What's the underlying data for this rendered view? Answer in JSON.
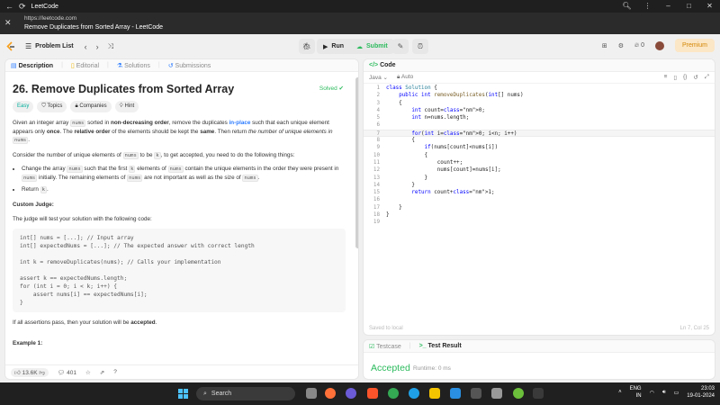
{
  "browser": {
    "app_name": "LeetCode",
    "url": "https://leetcode.com",
    "page_title": "Remove Duplicates from Sorted Array - LeetCode"
  },
  "nav": {
    "problem_list": "Problem List",
    "run": "Run",
    "submit": "Submit",
    "streak_count": "0",
    "premium": "Premium"
  },
  "left_tabs": [
    "Description",
    "Editorial",
    "Solutions",
    "Submissions"
  ],
  "problem": {
    "title": "26. Remove Duplicates from Sorted Array",
    "status": "Solved",
    "difficulty": "Easy",
    "topics": "Topics",
    "companies": "Companies",
    "hint": "Hint",
    "p1_a": "Given an integer array",
    "p1_code": "nums",
    "p1_b": "sorted in",
    "p1_bold1": "non-decreasing order",
    "p1_c": ", remove the duplicates",
    "p1_inplace": "in-place",
    "p1_d": "such that each unique element appears only",
    "p1_once": "once",
    "p1_e": ". The",
    "p1_relorder": "relative order",
    "p1_f": "of the elements should be kept the",
    "p1_same": "same",
    "p1_g": ". Then return",
    "p1_italic": "the number of unique elements in",
    "p1_code2": "nums",
    "p1_h": ".",
    "p2_a": "Consider the number of unique elements of",
    "p2_code": "nums",
    "p2_b": "to be",
    "p2_code2": "k",
    "p2_c": ", to get accepted, you need to do the following things:",
    "b1_a": "Change the array",
    "b1_code": "nums",
    "b1_b": "such that the first",
    "b1_code2": "k",
    "b1_c": "elements of",
    "b1_code3": "nums",
    "b1_d": "contain the unique elements in the order they were present in",
    "b1_code4": "nums",
    "b1_e": "initially. The remaining elements of",
    "b1_code5": "nums",
    "b1_f": "are not important as well as the size of",
    "b1_code6": "nums",
    "b1_g": ".",
    "b2_a": "Return",
    "b2_code": "k",
    "b2_b": ".",
    "custom_judge": "Custom Judge:",
    "judge_text": "The judge will test your solution with the following code:",
    "judge_code": "int[] nums = [...]; // Input array\nint[] expectedNums = [...]; // The expected answer with correct length\n\nint k = removeDuplicates(nums); // Calls your implementation\n\nassert k == expectedNums.length;\nfor (int i = 0; i < k; i++) {\n    assert nums[i] == expectedNums[i];\n}",
    "final_a": "If all assertions pass, then your solution will be",
    "final_bold": "accepted",
    "final_b": ".",
    "example1": "Example 1:"
  },
  "left_footer": {
    "likes": "13.6K",
    "comments": "401"
  },
  "code_panel": {
    "tab": "Code",
    "language": "Java",
    "auto": "Auto",
    "saved": "Saved to local",
    "cursor": "Ln 7, Col 25",
    "lines": [
      "class Solution {",
      "    public int removeDuplicates(int[] nums)",
      "    {",
      "        int count=0;",
      "        int n=nums.length;",
      "",
      "        for(int i=0; i<n; i++)",
      "        {",
      "            if(nums[count]<nums[i])",
      "            {",
      "                count++;",
      "                nums[count]=nums[i];",
      "            }",
      "        }",
      "        return count+1;",
      "",
      "    }",
      "}",
      ""
    ]
  },
  "result_panel": {
    "testcase": "Testcase",
    "test_result": "Test Result",
    "verdict": "Accepted",
    "runtime": "Runtime: 0 ms"
  },
  "taskbar": {
    "search": "Search",
    "lang": "ENG",
    "region": "IN",
    "time": "23:03",
    "date": "19-01-2024"
  }
}
